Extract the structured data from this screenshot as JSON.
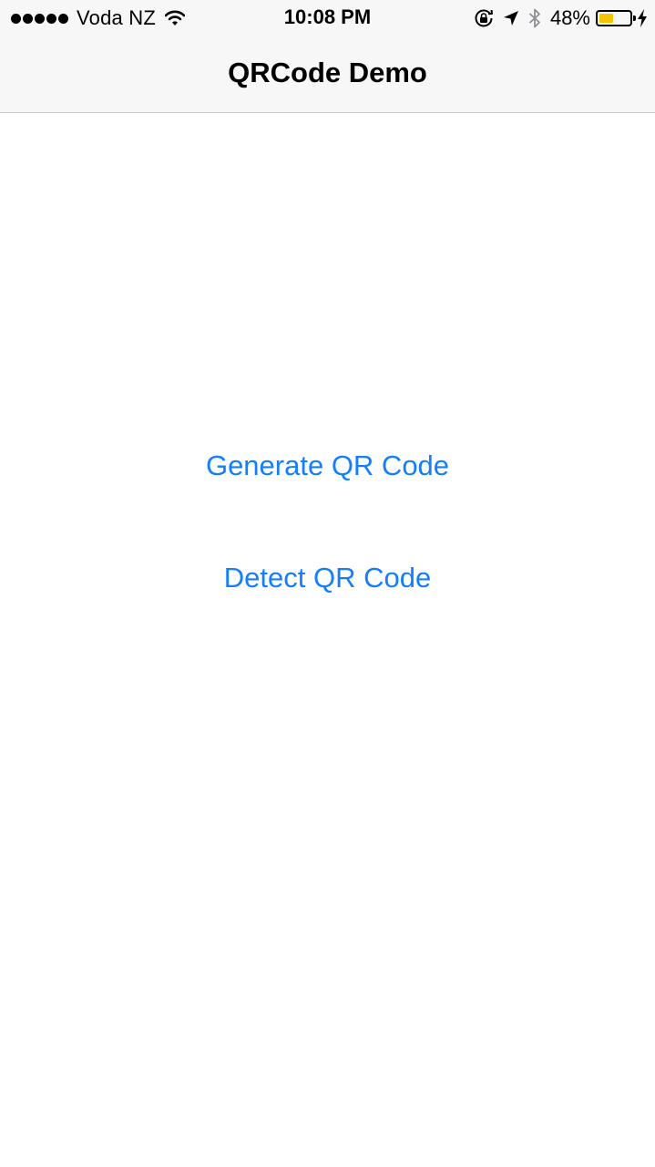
{
  "status_bar": {
    "carrier": "Voda NZ",
    "time": "10:08 PM",
    "battery_percent_label": "48%",
    "battery_level": 0.48,
    "battery_fill_color": "#f5c400",
    "icons": [
      "signal-dots-icon",
      "wifi-icon",
      "orientation-lock-icon",
      "location-arrow-icon",
      "bluetooth-icon",
      "battery-icon",
      "charging-bolt-icon"
    ]
  },
  "nav": {
    "title": "QRCode Demo"
  },
  "main": {
    "generate_label": "Generate QR Code",
    "detect_label": "Detect QR Code"
  },
  "colors": {
    "accent": "#147efb",
    "bar_background": "#f7f7f7",
    "separator": "#c8c7cc"
  }
}
